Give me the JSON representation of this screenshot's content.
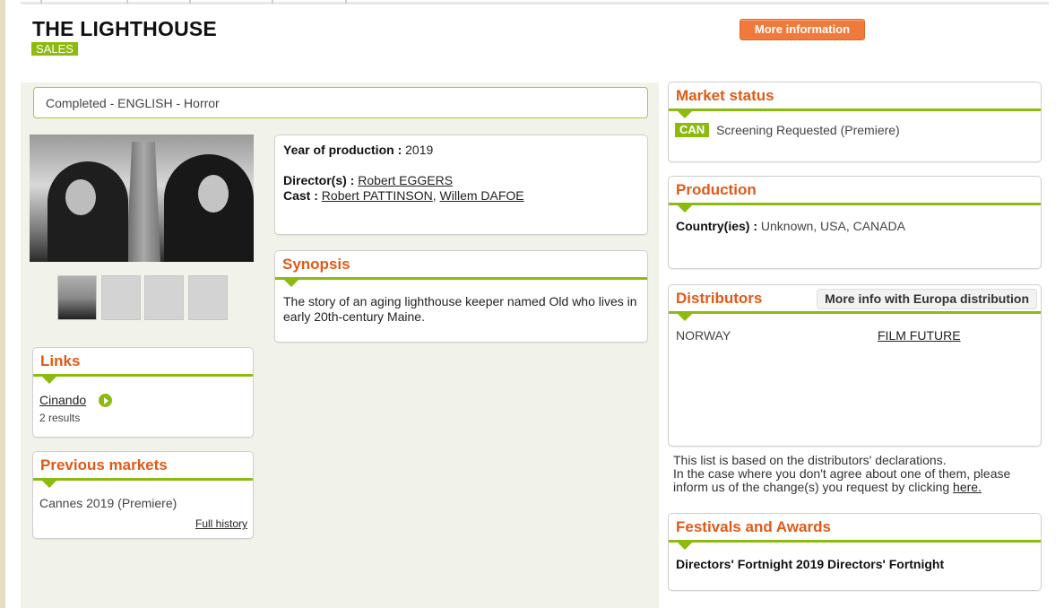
{
  "film": {
    "title": "THE LIGHTHOUSE",
    "badge": "SALES",
    "more_info_label": "More information",
    "genre_line": "Completed - ENGLISH - Horror"
  },
  "info": {
    "year_label": "Year of production :",
    "year_value": "2019",
    "directors_label": "Director(s) :",
    "director": "Robert EGGERS",
    "cast_label": "Cast :",
    "cast_1": "Robert PATTINSON",
    "cast_sep": ",",
    "cast_2": "Willem DAFOE"
  },
  "synopsis": {
    "heading": "Synopsis",
    "text": "The story of an aging lighthouse keeper named Old who lives in early 20th-century Maine."
  },
  "links": {
    "heading": "Links",
    "link_label": "Cinando",
    "results": "2 results"
  },
  "previous_markets": {
    "heading": "Previous markets",
    "item": "Cannes 2019 (Premiere)",
    "history_link": "Full history"
  },
  "market_status": {
    "heading": "Market status",
    "badge": "CAN",
    "status": "Screening Requested (Premiere)"
  },
  "production": {
    "heading": "Production",
    "country_label": "Country(ies) :",
    "countries": "Unknown, USA, CANADA"
  },
  "distributors": {
    "heading": "Distributors",
    "europa_button": "More info with Europa distribution",
    "rows": [
      {
        "country": "NORWAY",
        "company": "FILM FUTURE"
      }
    ]
  },
  "disclaimer": {
    "line1": "This list is based on the distributors' declarations.",
    "line2": "In the case where you don't agree about one of them, please inform us of the change(s) you request by clicking",
    "link": "here."
  },
  "festivals": {
    "heading": "Festivals and Awards",
    "item": "Directors' Fortnight 2019 Directors' Fortnight"
  },
  "colors": {
    "accent_green": "#8dba0f",
    "heading_orange": "#e05a17",
    "button_orange": "#f07a3c"
  }
}
